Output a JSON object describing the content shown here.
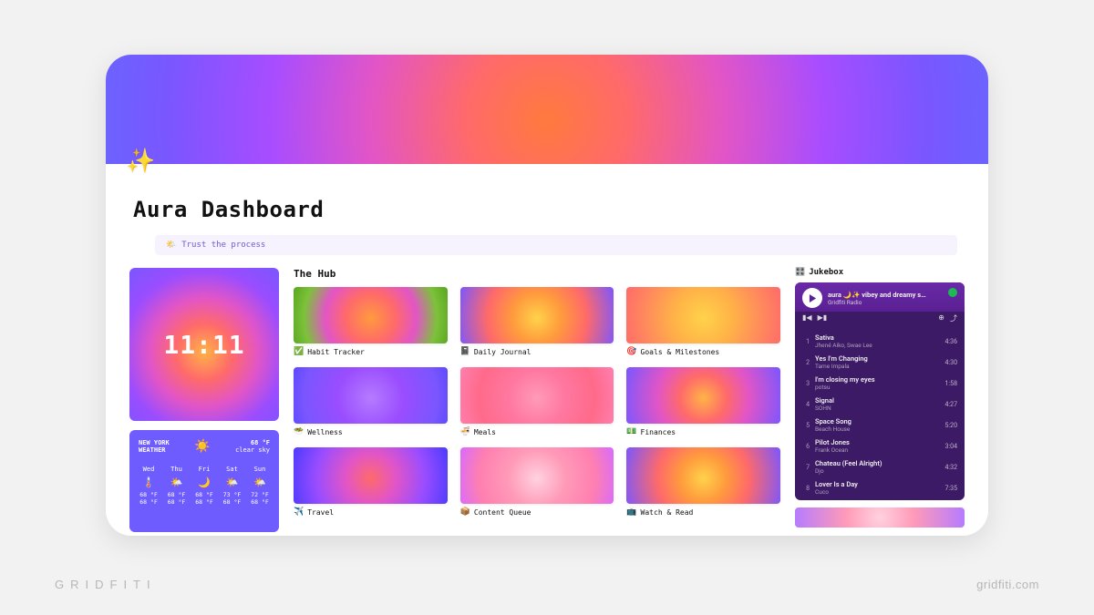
{
  "page": {
    "title": "Aura Dashboard",
    "motto": "Trust the process"
  },
  "clock": {
    "time": "11:11"
  },
  "weather": {
    "city_line1": "NEW YORK",
    "city_line2": "WEATHER",
    "now_temp": "68 °F",
    "now_cond": "clear sky",
    "forecast": [
      {
        "day": "Wed",
        "icon": "🌡️",
        "hi": "68 °F",
        "lo": "68 °F"
      },
      {
        "day": "Thu",
        "icon": "🌤️",
        "hi": "68 °F",
        "lo": "68 °F"
      },
      {
        "day": "Fri",
        "icon": "🌙",
        "hi": "68 °F",
        "lo": "68 °F"
      },
      {
        "day": "Sat",
        "icon": "🌤️",
        "hi": "73 °F",
        "lo": "68 °F"
      },
      {
        "day": "Sun",
        "icon": "🌤️",
        "hi": "72 °F",
        "lo": "68 °F"
      }
    ]
  },
  "hub": {
    "title": "The Hub",
    "items": [
      {
        "icon": "✅",
        "label": "Habit Tracker"
      },
      {
        "icon": "📓",
        "label": "Daily Journal"
      },
      {
        "icon": "🎯",
        "label": "Goals & Milestones"
      },
      {
        "icon": "🥗",
        "label": "Wellness"
      },
      {
        "icon": "🍜",
        "label": "Meals"
      },
      {
        "icon": "💵",
        "label": "Finances"
      },
      {
        "icon": "✈️",
        "label": "Travel"
      },
      {
        "icon": "📦",
        "label": "Content Queue"
      },
      {
        "icon": "📺",
        "label": "Watch & Read"
      }
    ]
  },
  "jukebox": {
    "title": "Jukebox",
    "playlist_title": "aura 🌙✨ vibey and dreamy s…",
    "playlist_artist": "Gridfiti Radio",
    "tracks": [
      {
        "n": "1",
        "name": "Sativa",
        "artist": "Jhené Aiko, Swae Lee",
        "dur": "4:36"
      },
      {
        "n": "2",
        "name": "Yes I'm Changing",
        "artist": "Tame Impala",
        "dur": "4:30"
      },
      {
        "n": "3",
        "name": "I'm closing my eyes",
        "artist": "potsu",
        "dur": "1:58"
      },
      {
        "n": "4",
        "name": "Signal",
        "artist": "SOHN",
        "dur": "4:27"
      },
      {
        "n": "5",
        "name": "Space Song",
        "artist": "Beach House",
        "dur": "5:20"
      },
      {
        "n": "6",
        "name": "Pilot Jones",
        "artist": "Frank Ocean",
        "dur": "3:04"
      },
      {
        "n": "7",
        "name": "Chateau (Feel Alright)",
        "artist": "Djo",
        "dur": "4:32"
      },
      {
        "n": "8",
        "name": "Lover Is a Day",
        "artist": "Cuco",
        "dur": "7:35"
      }
    ]
  },
  "footer": {
    "brand": "GRIDFITI",
    "url": "gridfiti.com"
  }
}
